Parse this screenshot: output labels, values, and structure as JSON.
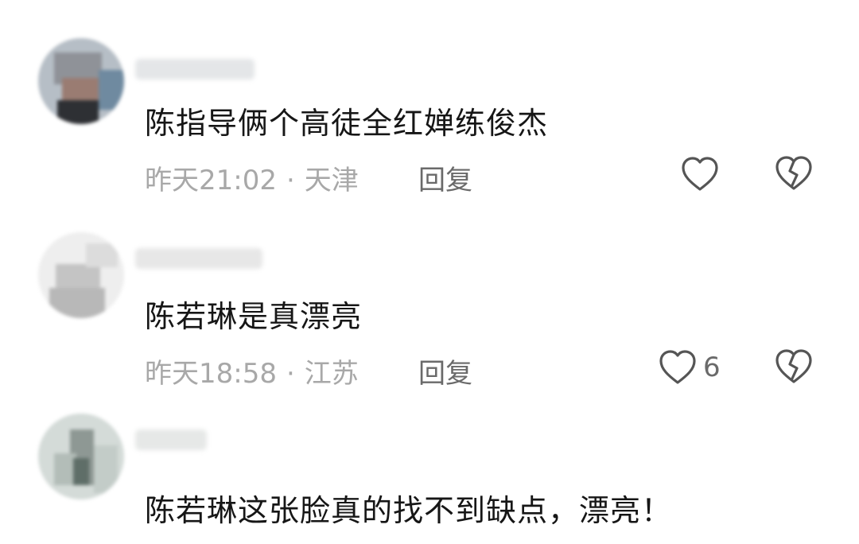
{
  "comments": [
    {
      "text": "陈指导俩个高徒全红婵练俊杰",
      "time": "昨天21:02",
      "location": "天津",
      "reply_label": "回复",
      "like_count": ""
    },
    {
      "text": "陈若琳是真漂亮",
      "time": "昨天18:58",
      "location": "江苏",
      "reply_label": "回复",
      "like_count": "6"
    },
    {
      "text": "陈若琳这张脸真的找不到缺点，漂亮！",
      "time": "",
      "location": "",
      "reply_label": "",
      "like_count": ""
    }
  ],
  "separator": "·",
  "icons": {
    "like": "heart-outline-icon",
    "dislike": "broken-heart-icon"
  },
  "colors": {
    "text": "#161616",
    "meta": "#a8a8a8",
    "action": "#6a6a6a",
    "icon_stroke": "#555555"
  }
}
